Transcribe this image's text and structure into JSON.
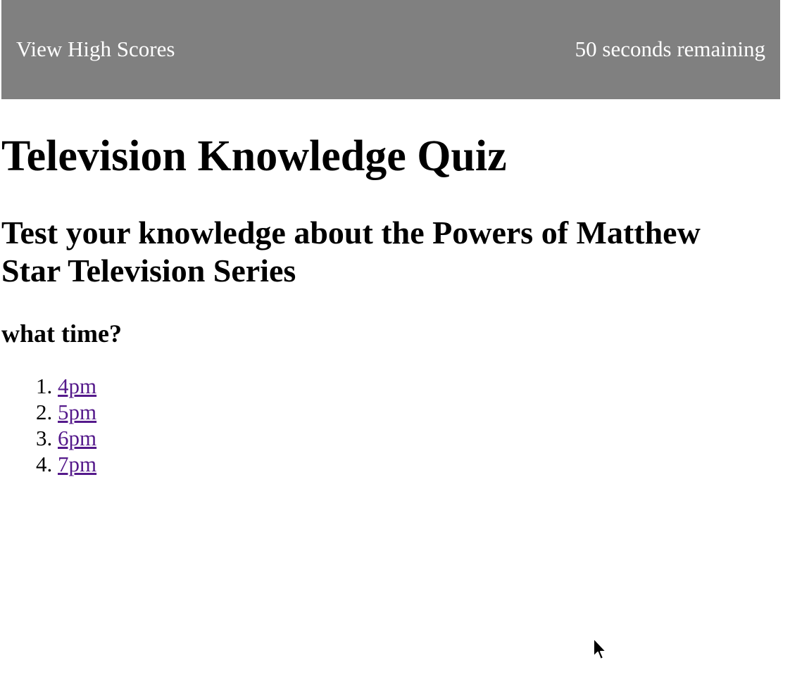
{
  "header": {
    "high_scores_label": "View High Scores",
    "timer_text": "50 seconds remaining",
    "background_color": "#808080",
    "text_color": "#ffffff"
  },
  "main": {
    "title": "Television Knowledge Quiz",
    "subtitle": "Test your knowledge about the Powers of Matthew Star Television Series",
    "question": "what time?",
    "answers": [
      "4pm",
      "5pm",
      "6pm",
      "7pm"
    ],
    "link_color": "#551a8b"
  },
  "cursor": {
    "icon": "mouse-pointer-icon"
  }
}
